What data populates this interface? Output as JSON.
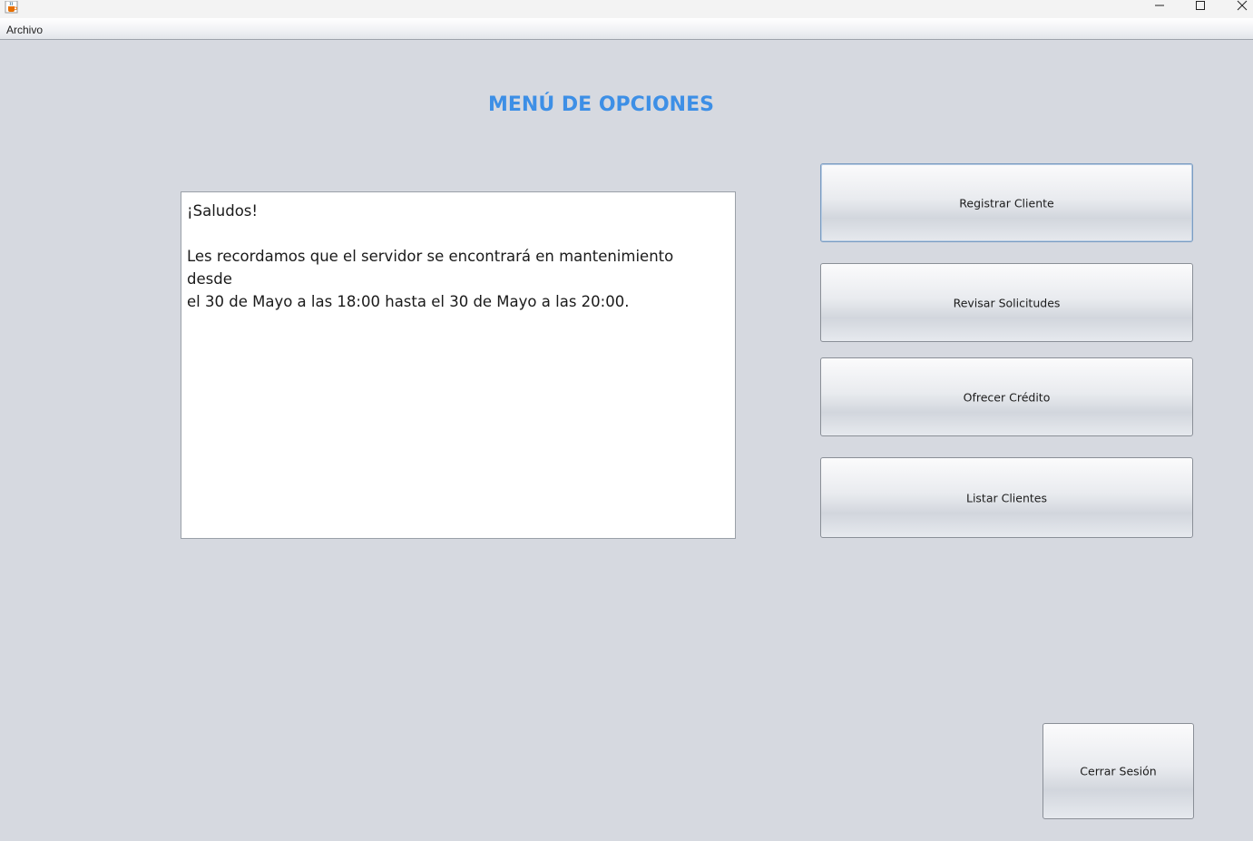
{
  "window": {
    "icon": "java-cup-icon",
    "controls": {
      "minimize_icon": "minimize-icon",
      "maximize_icon": "maximize-icon",
      "close_icon": "close-icon"
    }
  },
  "menubar": {
    "items": [
      {
        "label": "Archivo"
      }
    ]
  },
  "main": {
    "title": "MENÚ DE OPCIONES",
    "title_color": "#3d8fe6",
    "message": {
      "greeting": "¡Saludos!",
      "body_line1": "Les recordamos que el servidor se encontrará en mantenimiento desde",
      "body_line2": "el 30 de Mayo a las 18:00 hasta el 30 de Mayo a las 20:00."
    },
    "buttons": {
      "registrar": "Registrar Cliente",
      "revisar": "Revisar Solicitudes",
      "ofrecer": "Ofrecer Crédito",
      "listar": "Listar Clientes",
      "cerrar": "Cerrar Sesión"
    }
  }
}
